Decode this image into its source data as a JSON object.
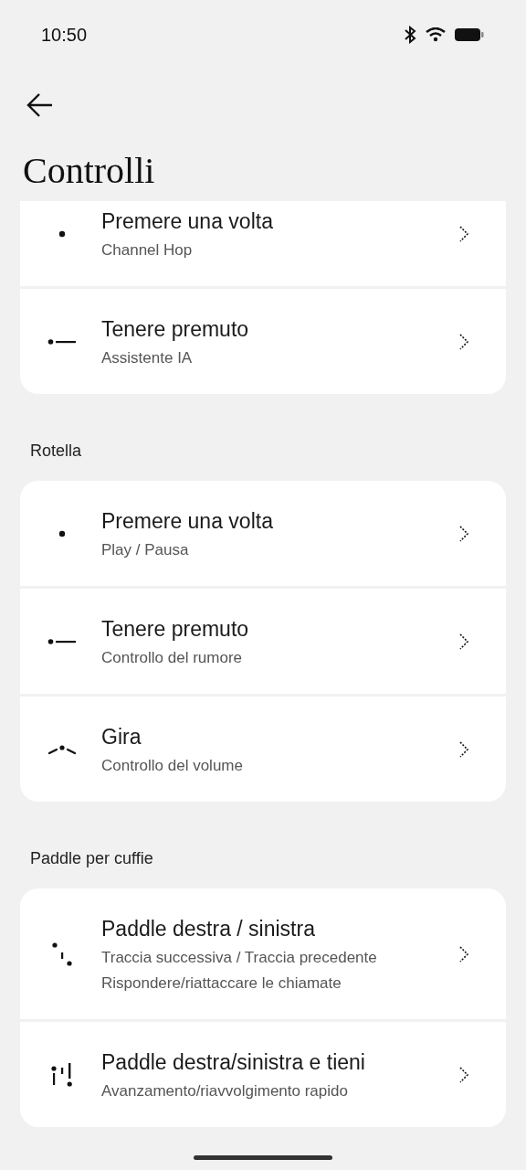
{
  "status_bar": {
    "time": "10:50"
  },
  "header": {
    "title": "Controlli"
  },
  "sections": [
    {
      "items": [
        {
          "kind": "press",
          "title": "Premere una volta",
          "subtitles": [
            "Channel Hop"
          ]
        },
        {
          "kind": "hold",
          "title": "Tenere premuto",
          "subtitles": [
            "Assistente IA"
          ]
        }
      ]
    },
    {
      "heading": "Rotella",
      "items": [
        {
          "kind": "press",
          "title": "Premere una volta",
          "subtitles": [
            "Play / Pausa"
          ]
        },
        {
          "kind": "hold",
          "title": "Tenere premuto",
          "subtitles": [
            "Controllo del rumore"
          ]
        },
        {
          "kind": "rotate",
          "title": "Gira",
          "subtitles": [
            "Controllo del volume"
          ]
        }
      ]
    },
    {
      "heading": "Paddle per cuffie",
      "items": [
        {
          "kind": "paddle",
          "title": "Paddle destra / sinistra",
          "subtitles": [
            "Traccia successiva / Traccia precedente",
            "Rispondere/riattaccare le chiamate"
          ]
        },
        {
          "kind": "paddle_hold",
          "title": "Paddle destra/sinistra e tieni",
          "subtitles": [
            "Avanzamento/riavvolgimento rapido"
          ]
        }
      ]
    }
  ]
}
